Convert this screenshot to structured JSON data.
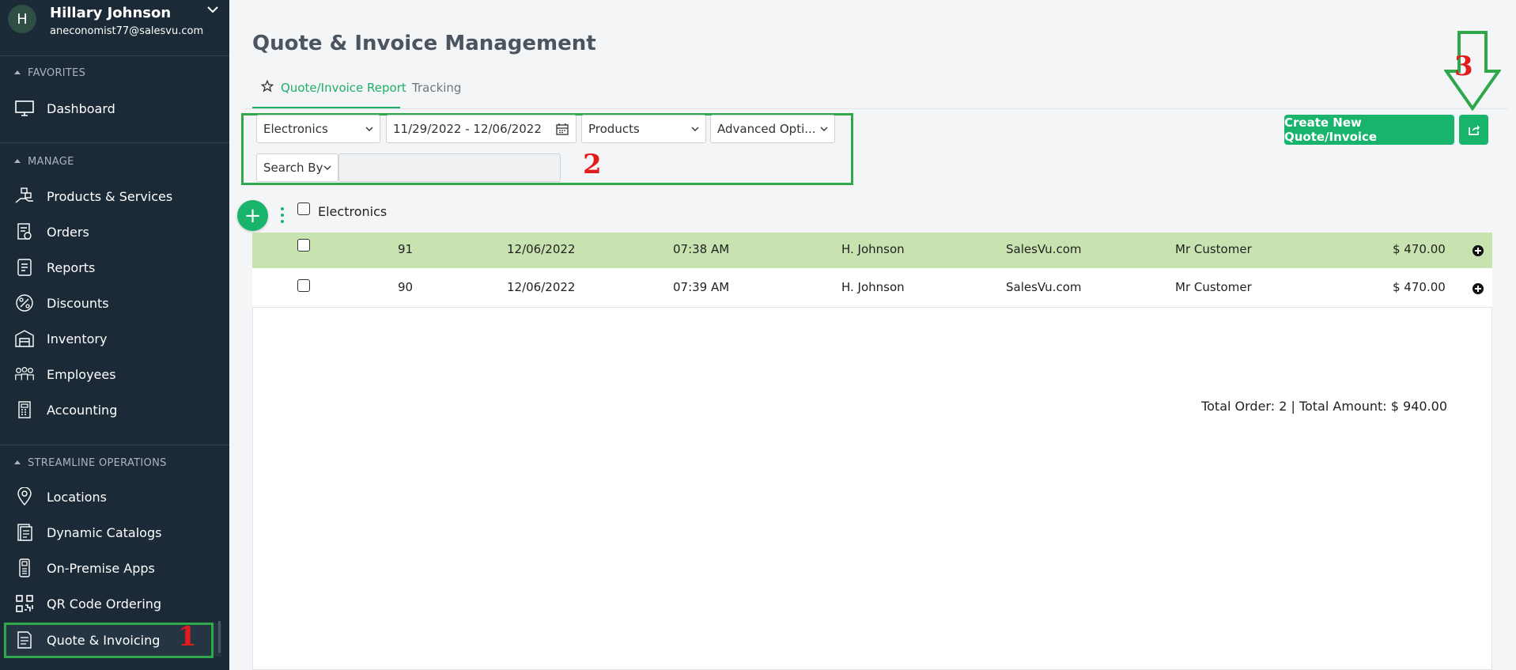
{
  "user": {
    "initial": "H",
    "name": "Hillary Johnson",
    "email": "aneconomist77@salesvu.com"
  },
  "sidebar": {
    "favorites_title": "FAVORITES",
    "favorites": [
      {
        "label": "Dashboard",
        "icon": "monitor-icon"
      }
    ],
    "manage_title": "MANAGE",
    "manage": [
      {
        "label": "Products & Services",
        "icon": "hand-boxes-icon"
      },
      {
        "label": "Orders",
        "icon": "orders-icon"
      },
      {
        "label": "Reports",
        "icon": "reports-icon"
      },
      {
        "label": "Discounts",
        "icon": "percent-icon"
      },
      {
        "label": "Inventory",
        "icon": "warehouse-icon"
      },
      {
        "label": "Employees",
        "icon": "employees-icon"
      },
      {
        "label": "Accounting",
        "icon": "calculator-icon"
      }
    ],
    "streamline_title": "STREAMLINE OPERATIONS",
    "streamline": [
      {
        "label": "Locations",
        "icon": "location-pin-icon"
      },
      {
        "label": "Dynamic Catalogs",
        "icon": "catalog-icon"
      },
      {
        "label": "On-Premise Apps",
        "icon": "pos-terminal-icon"
      },
      {
        "label": "QR Code Ordering",
        "icon": "qr-code-icon"
      },
      {
        "label": "Quote & Invoicing",
        "icon": "invoice-icon"
      }
    ]
  },
  "annotations": {
    "one": "1",
    "two": "2",
    "three": "3"
  },
  "page": {
    "title": "Quote & Invoice Management",
    "tabs": [
      {
        "label": "Quote/Invoice Report",
        "active": true
      },
      {
        "label": "Tracking",
        "active": false
      }
    ]
  },
  "filters": {
    "location": "Electronics",
    "date_range": "11/29/2022 - 12/06/2022",
    "type": "Products",
    "advanced": "Advanced Opti...",
    "search_by": "Search By",
    "search_value": ""
  },
  "actions": {
    "create_label": "Create New Quote/Invoice"
  },
  "table": {
    "group_label": "Electronics",
    "totals": "Total Order: 2 | Total Amount: $ 940.00",
    "rows": [
      {
        "id": "91",
        "date": "12/06/2022",
        "time": "07:38 AM",
        "employee": "H. Johnson",
        "company": "SalesVu.com",
        "customer": "Mr Customer",
        "amount": "$ 470.00",
        "highlighted": true
      },
      {
        "id": "90",
        "date": "12/06/2022",
        "time": "07:39 AM",
        "employee": "H. Johnson",
        "company": "SalesVu.com",
        "customer": "Mr Customer",
        "amount": "$ 470.00",
        "highlighted": false
      }
    ]
  },
  "colors": {
    "sidebar_bg": "#1c2a38",
    "accent_green": "#18b46c",
    "annotation_green": "#2ea84a",
    "annotation_red": "#e41b1b",
    "row_highlight": "#c9e3b0"
  }
}
